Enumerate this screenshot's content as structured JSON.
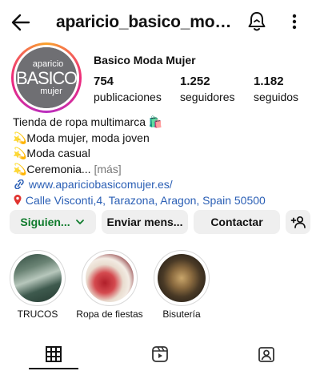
{
  "header": {
    "title": "aparicio_basico_moda_mujer",
    "back_icon": "arrow-left-icon",
    "bell_icon": "bell-icon",
    "more_icon": "more-vertical-icon"
  },
  "avatar": {
    "logo_top": "aparicio",
    "logo_main": "BASICO",
    "logo_bottom": "mujer"
  },
  "profile": {
    "name": "Basico Moda Mujer",
    "stats": [
      {
        "value": "754",
        "label": "publicaciones"
      },
      {
        "value": "1.252",
        "label": "seguidores"
      },
      {
        "value": "1.182",
        "label": "seguidos"
      }
    ]
  },
  "bio": {
    "line1": "Tienda de ropa multimarca 🛍️",
    "line2": "💫Moda mujer, moda joven",
    "line3": "💫Moda casual",
    "line4": "💫Ceremonia...",
    "more": " [más]",
    "link": "www.apariciobasicomujer.es/",
    "address": "Calle Visconti,4, Tarazona, Aragon, Spain 50500"
  },
  "actions": {
    "following": "Siguien...",
    "message": "Enviar mens...",
    "contact": "Contactar"
  },
  "highlights": [
    {
      "label": "TRUCOS"
    },
    {
      "label": "Ropa de fiestas"
    },
    {
      "label": "Bisutería"
    }
  ],
  "tabs": {
    "grid_icon": "grid-icon",
    "reels_icon": "reels-icon",
    "tagged_icon": "tagged-icon"
  },
  "colors": {
    "following_green": "#0f7b2c",
    "link_blue": "#2b5fb5",
    "button_bg": "#efefef"
  }
}
